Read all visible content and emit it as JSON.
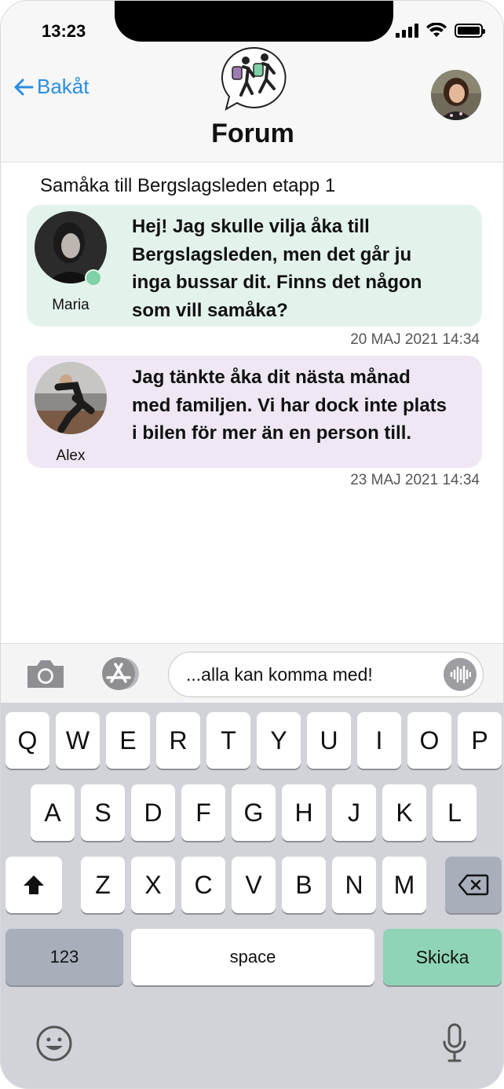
{
  "status_bar": {
    "time": "13:23"
  },
  "header": {
    "back_label": "Bakåt",
    "title": "Forum"
  },
  "thread": {
    "title": "Samåka till Bergslagsleden etapp 1",
    "messages": [
      {
        "author": "Maria",
        "lines": [
          "Hej! Jag skulle vilja åka till",
          "Bergslagsleden, men det går ju",
          "inga bussar dit. Finns det någon",
          "som vill samåka?"
        ],
        "timestamp": "20 MAJ 2021 14:34",
        "online": true
      },
      {
        "author": "Alex",
        "lines": [
          "Jag tänkte åka dit nästa månad",
          "med familjen. Vi har dock inte plats",
          "i bilen för mer än en person till."
        ],
        "timestamp": "23 MAJ 2021 14:34",
        "online": false
      }
    ]
  },
  "composer": {
    "text": "...alla kan komma med!"
  },
  "keyboard": {
    "row1": [
      "Q",
      "W",
      "E",
      "R",
      "T",
      "Y",
      "U",
      "I",
      "O",
      "P"
    ],
    "row2": [
      "A",
      "S",
      "D",
      "F",
      "G",
      "H",
      "J",
      "K",
      "L"
    ],
    "row3": [
      "Z",
      "X",
      "C",
      "V",
      "B",
      "N",
      "M"
    ],
    "numbers_label": "123",
    "space_label": "space",
    "send_label": "Skicka"
  },
  "colors": {
    "accent_blue": "#2b8de0",
    "maria_bubble": "#e3f3ec",
    "alex_bubble": "#efe8f4",
    "send_key": "#8fd4b6"
  }
}
